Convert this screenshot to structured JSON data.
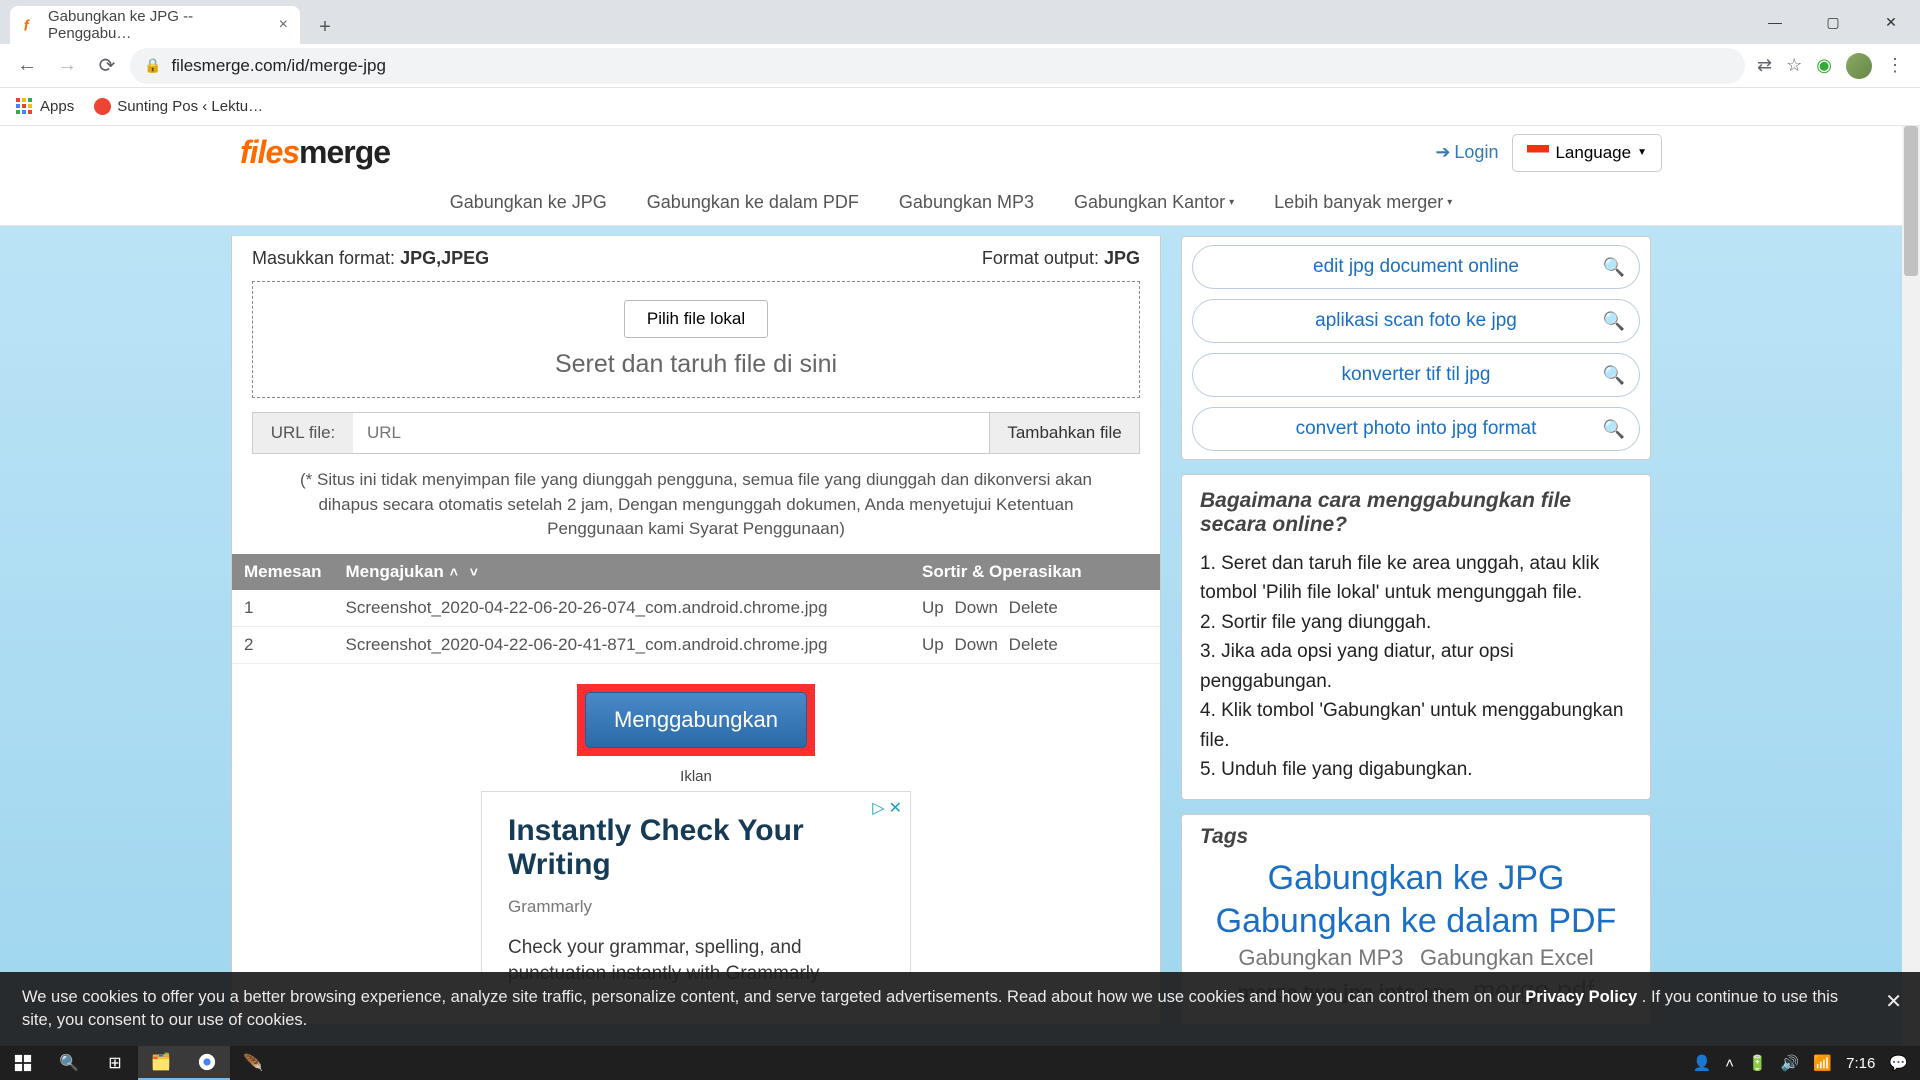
{
  "browser": {
    "tab_title": "Gabungkan ke JPG -- Penggabu…",
    "address": "filesmerge.com/id/merge-jpg",
    "bookmarks": {
      "apps": "Apps",
      "bm1": "Sunting Pos ‹ Lektu…"
    }
  },
  "header": {
    "logo_f": "files",
    "logo_rest": "merge",
    "login": "Login",
    "language": "Language"
  },
  "nav": {
    "n1": "Gabungkan ke JPG",
    "n2": "Gabungkan ke dalam PDF",
    "n3": "Gabungkan MP3",
    "n4": "Gabungkan Kantor",
    "n5": "Lebih banyak merger"
  },
  "main": {
    "input_fmt_label": "Masukkan format: ",
    "input_fmt_value": "JPG,JPEG",
    "output_fmt_label": "Format output: ",
    "output_fmt_value": "JPG",
    "pick_local": "Pilih file lokal",
    "dnd": "Seret dan taruh file di sini",
    "url_label": "URL file:",
    "url_placeholder": "URL",
    "add_file": "Tambahkan file",
    "disclaimer": "(* Situs ini tidak menyimpan file yang diunggah pengguna, semua file yang diunggah dan dikonversi akan dihapus secara otomatis setelah 2 jam, Dengan mengunggah dokumen, Anda menyetujui Ketentuan Penggunaan kami Syarat Penggunaan)",
    "th_order": "Memesan",
    "th_file": "Mengajukan",
    "th_ops": "Sortir & Operasikan",
    "rows": [
      {
        "n": "1",
        "name": "Screenshot_2020-04-22-06-20-26-074_com.android.chrome.jpg",
        "up": "Up",
        "down": "Down",
        "del": "Delete"
      },
      {
        "n": "2",
        "name": "Screenshot_2020-04-22-06-20-41-871_com.android.chrome.jpg",
        "up": "Up",
        "down": "Down",
        "del": "Delete"
      }
    ],
    "merge_btn": "Menggabungkan",
    "ad_label": "Iklan",
    "ad_title": "Instantly Check Your Writing",
    "ad_brand": "Grammarly",
    "ad_copy": "Check your grammar, spelling, and punctuation instantly with Grammarly"
  },
  "related": {
    "q1": "edit jpg document online",
    "q2": "aplikasi scan foto ke jpg",
    "q3": "konverter tif til jpg",
    "q4": "convert photo into jpg format"
  },
  "howto": {
    "title": "Bagaimana cara menggabungkan file secara online?",
    "s1": "1. Seret dan taruh file ke area unggah, atau klik tombol 'Pilih file lokal' untuk mengunggah file.",
    "s2": "2. Sortir file yang diunggah.",
    "s3": "3. Jika ada opsi yang diatur, atur opsi penggabungan.",
    "s4": "4. Klik tombol 'Gabungkan' untuk menggabungkan file.",
    "s5": "5. Unduh file yang digabungkan."
  },
  "tags": {
    "title": "Tags",
    "t1": "Gabungkan ke JPG",
    "t2": "Gabungkan ke dalam PDF",
    "t3": "Gabungkan MP3",
    "t4": "Gabungkan Excel",
    "t5": "merge two jpg into one",
    "t6": "merge pdf"
  },
  "cookie": {
    "text1": "We use cookies to offer you a better browsing experience, analyze site traffic, personalize content, and serve targeted advertisements. Read about how we use cookies and how you can control them on our ",
    "policy": "Privacy Policy",
    "text2": ". If you continue to use this site, you consent to our use of cookies."
  },
  "taskbar": {
    "clock": "7:16"
  }
}
